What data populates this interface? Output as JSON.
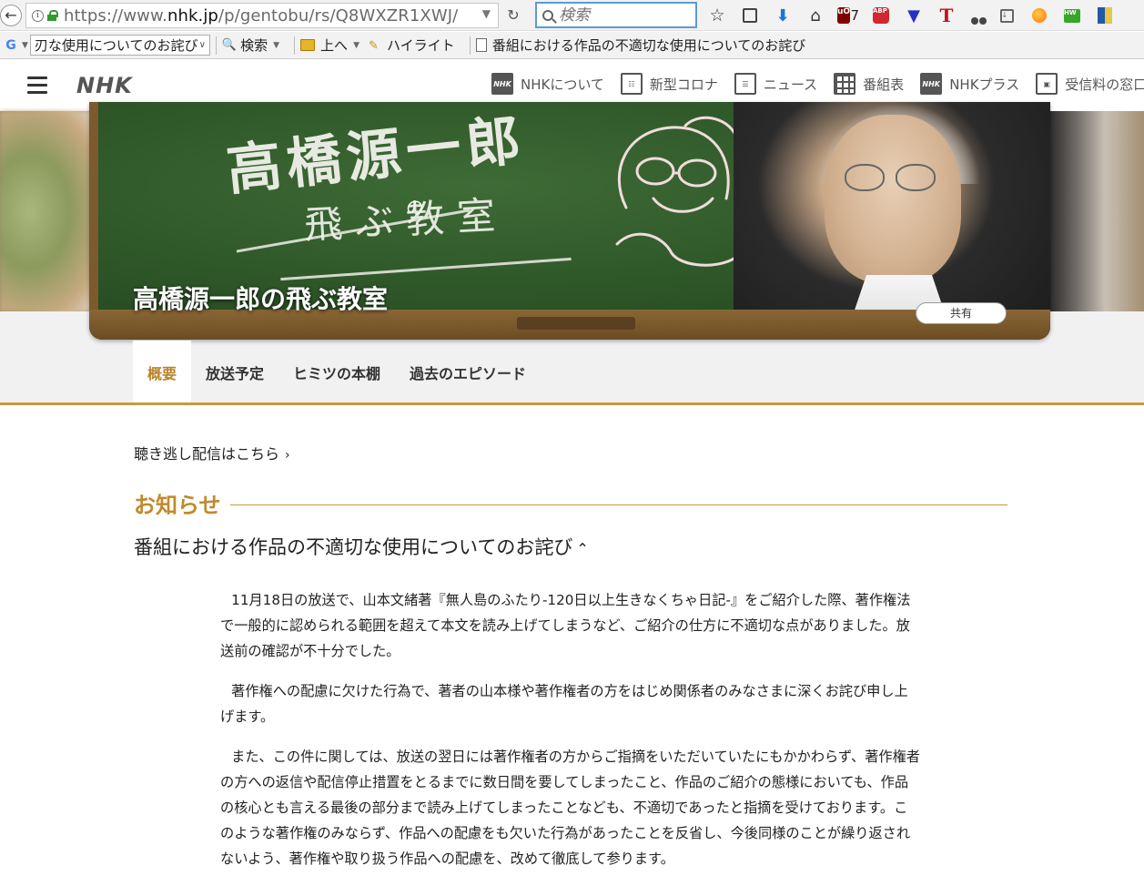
{
  "browser": {
    "url_prefix": "https://www.",
    "url_domain": "nhk.jp",
    "url_path": "/p/gentobu/rs/Q8WXZR1XWJ/",
    "search_placeholder": "検索",
    "ublock_badge": "7",
    "bookmarks": {
      "search_field_value": "刃な使用についてのお詫び",
      "search_label": "検索",
      "up_label": "上へ",
      "highlight_label": "ハイライト",
      "page_label": "番組における作品の不適切な使用についてのお詫び"
    }
  },
  "nhk": {
    "logo": "NHK",
    "nav": [
      {
        "label": "NHKについて",
        "icon": "nhk-logo-icon"
      },
      {
        "label": "新型コロナ",
        "icon": "virus-info-icon"
      },
      {
        "label": "ニュース",
        "icon": "news-icon"
      },
      {
        "label": "番組表",
        "icon": "program-grid-icon"
      },
      {
        "label": "NHKプラス",
        "icon": "nhk-plus-icon"
      },
      {
        "label": "受信料の窓口",
        "icon": "fee-window-icon"
      }
    ]
  },
  "hero": {
    "title": "高橋源一郎の飛ぶ教室",
    "share_label": "共有"
  },
  "tabs": [
    {
      "label": "概要",
      "active": true
    },
    {
      "label": "放送予定",
      "active": false
    },
    {
      "label": "ヒミツの本棚",
      "active": false
    },
    {
      "label": "過去のエピソード",
      "active": false
    }
  ],
  "content": {
    "catchup_link": "聴き逃し配信はこちら",
    "notice_heading": "お知らせ",
    "apology_title": "番組における作品の不適切な使用についてのお詫び",
    "paragraphs": [
      "11月18日の放送で、山本文緒著『無人島のふたり-120日以上生きなくちゃ日記-』をご紹介した際、著作権法で一般的に認められる範囲を超えて本文を読み上げてしまうなど、ご紹介の仕方に不適切な点がありました。放送前の確認が不十分でした。",
      "著作権への配慮に欠けた行為で、著者の山本様や著作権者の方をはじめ関係者のみなさまに深くお詫び申し上げます。",
      "また、この件に関しては、放送の翌日には著作権者の方からご指摘をいただいていたにもかかわらず、著作権者の方への返信や配信停止措置をとるまでに数日間を要してしまったこと、作品のご紹介の態様においても、作品の核心とも言える最後の部分まで読み上げてしまったことなども、不適切であったと指摘を受けております。このような著作権のみならず、作品への配慮をも欠いた行為があったことを反省し、今後同様のことが繰り返されないよう、著作権や取り扱う作品への配慮を、改めて徹底して参ります。"
    ]
  }
}
